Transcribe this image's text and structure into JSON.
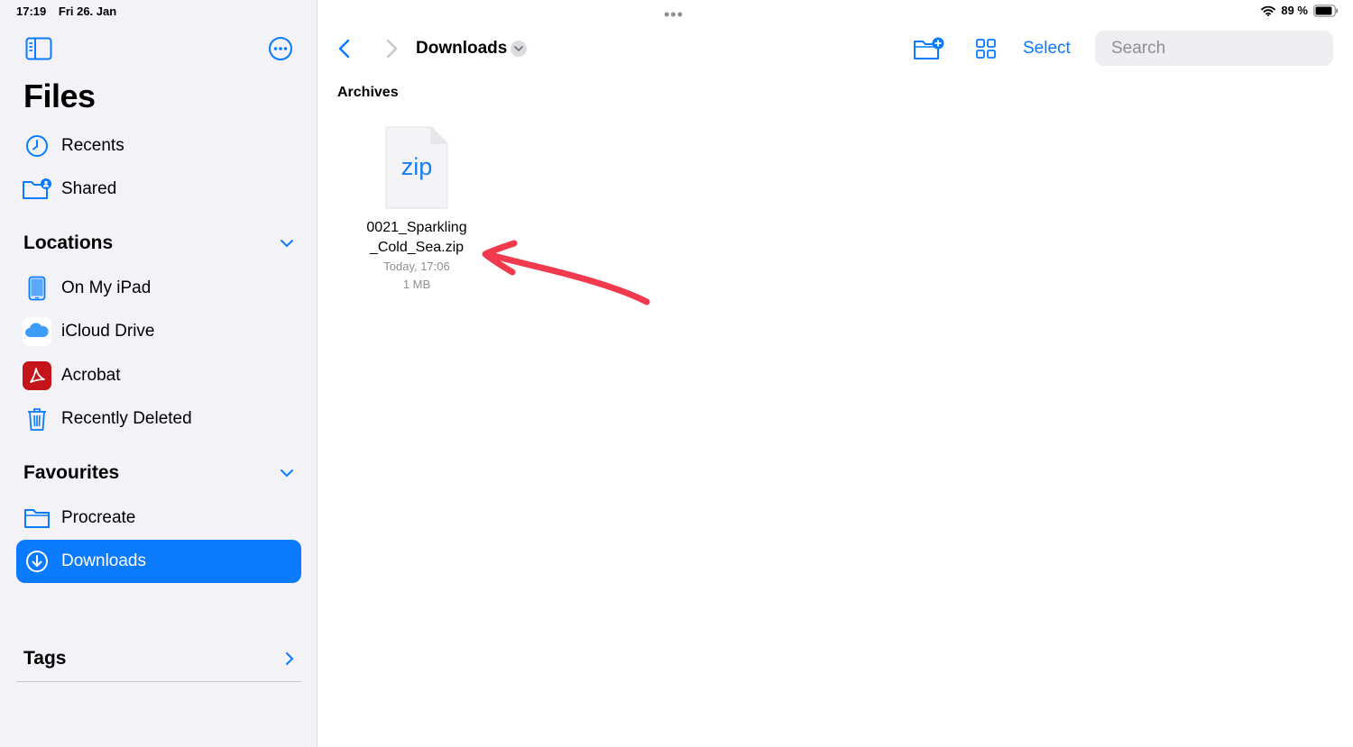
{
  "status": {
    "time": "17:19",
    "date": "Fri 26. Jan",
    "battery": "89 %"
  },
  "sidebar": {
    "title": "Files",
    "top_items": [
      {
        "label": "Recents",
        "icon": "clock-icon"
      },
      {
        "label": "Shared",
        "icon": "shared-folder-icon"
      }
    ],
    "locations": {
      "header": "Locations",
      "items": [
        {
          "label": "On My iPad",
          "icon": "ipad-icon"
        },
        {
          "label": "iCloud Drive",
          "icon": "icloud-icon"
        },
        {
          "label": "Acrobat",
          "icon": "acrobat-icon"
        },
        {
          "label": "Recently Deleted",
          "icon": "trash-icon"
        }
      ]
    },
    "favourites": {
      "header": "Favourites",
      "items": [
        {
          "label": "Procreate",
          "icon": "folder-icon"
        },
        {
          "label": "Downloads",
          "icon": "download-icon",
          "selected": true
        }
      ]
    },
    "tags": {
      "header": "Tags"
    }
  },
  "toolbar": {
    "folder_title": "Downloads",
    "select_label": "Select",
    "search_placeholder": "Search"
  },
  "content": {
    "section": "Archives",
    "files": [
      {
        "type_label": "zip",
        "name_line1": "0021_Sparkling",
        "name_line2": "_Cold_Sea.zip",
        "date": "Today, 17:06",
        "size": "1 MB"
      }
    ]
  },
  "colors": {
    "accent": "#0a7aff",
    "annotation": "#f23a4e",
    "acrobat": "#c4141a"
  }
}
